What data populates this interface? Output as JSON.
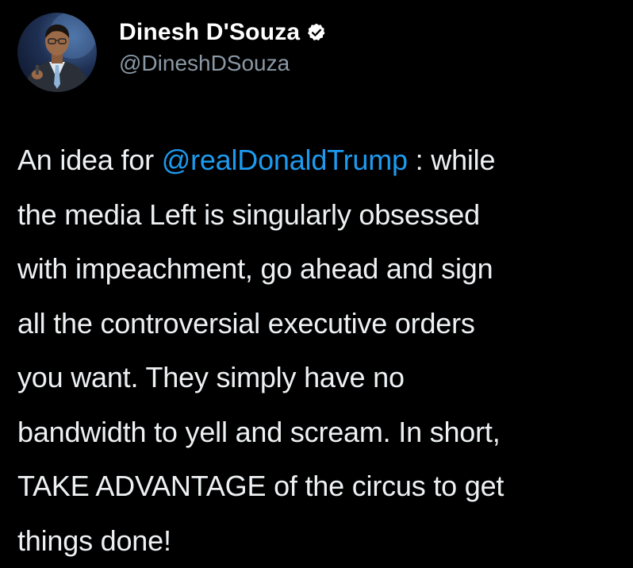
{
  "author": {
    "display_name": "Dinesh D'Souza",
    "handle": "@DineshDSouza",
    "verified": true,
    "verified_icon": "verified-badge-icon"
  },
  "tweet": {
    "lines": [
      {
        "pre": "An idea for ",
        "mention": "@realDonaldTrump",
        "post": " : while"
      },
      {
        "text": "the media Left is singularly obsessed"
      },
      {
        "text": "with impeachment, go ahead and sign"
      },
      {
        "text": "all the controversial executive orders"
      },
      {
        "text": "you want. They simply have no"
      },
      {
        "text": "bandwidth to yell and scream. In short,"
      },
      {
        "text": "TAKE ADVANTAGE of the circus to get"
      },
      {
        "text": "things done!"
      }
    ]
  },
  "colors": {
    "background": "#000000",
    "text": "#eef1f3",
    "mention": "#1d9bf0",
    "handle": "#8b98a5"
  }
}
